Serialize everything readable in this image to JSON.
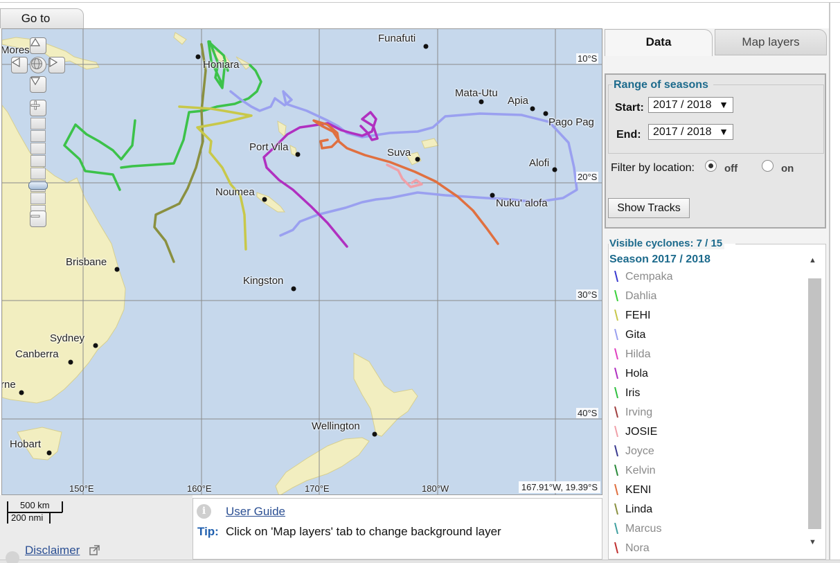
{
  "goto_tab": "Go to",
  "map": {
    "places": [
      {
        "id": "moresby",
        "label": "Mores"
      },
      {
        "id": "honiara",
        "label": "Honiara"
      },
      {
        "id": "funafuti",
        "label": "Funafuti"
      },
      {
        "id": "mata-utu",
        "label": "Mata-Utu"
      },
      {
        "id": "apia",
        "label": "Apia"
      },
      {
        "id": "pago-pago",
        "label": "Pago Pag"
      },
      {
        "id": "port-vila",
        "label": "Port Vila"
      },
      {
        "id": "suva",
        "label": "Suva"
      },
      {
        "id": "alofi",
        "label": "Alofi"
      },
      {
        "id": "noumea",
        "label": "Noumea"
      },
      {
        "id": "nukualofa",
        "label": "Nuku' alofa"
      },
      {
        "id": "brisbane",
        "label": "Brisbane"
      },
      {
        "id": "kingston",
        "label": "Kingston"
      },
      {
        "id": "sydney",
        "label": "Sydney"
      },
      {
        "id": "canberra",
        "label": "Canberra"
      },
      {
        "id": "melbourne",
        "label": "rne"
      },
      {
        "id": "wellington",
        "label": "Wellington"
      },
      {
        "id": "hobart",
        "label": "Hobart"
      }
    ],
    "lat_labels": [
      "10°S",
      "20°S",
      "30°S",
      "40°S"
    ],
    "lon_labels": [
      "150°E",
      "160°E",
      "170°E",
      "180°W"
    ],
    "coord_readout": "167.91°W, 19.39°S"
  },
  "scale": {
    "km": "500 km",
    "nmi": "200 nmi"
  },
  "disclaimer": "Disclaimer",
  "tip": {
    "guide_link": "User Guide",
    "label": "Tip:",
    "text": "Click on 'Map layers' tab to change background layer"
  },
  "tabs": {
    "data": "Data",
    "layers": "Map layers"
  },
  "range": {
    "legend": "Range of seasons",
    "start_label": "Start:",
    "start_value": "2017 / 2018",
    "end_label": "End:",
    "end_value": "2017 / 2018",
    "arrow": "▼"
  },
  "filter": {
    "label": "Filter by location:",
    "off": "off",
    "on": "on",
    "selected": "off"
  },
  "show_tracks": "Show Tracks",
  "visible_cyclones": "Visible cyclones: 7 / 15",
  "season_title": "Season 2017 / 2018",
  "cyclones": [
    {
      "name": "Cempaka",
      "color": "#3a3ad0",
      "visible": false
    },
    {
      "name": "Dahlia",
      "color": "#3ad13a",
      "visible": false
    },
    {
      "name": "FEHI",
      "color": "#c8c84a",
      "visible": true
    },
    {
      "name": "Gita",
      "color": "#9aa0f0",
      "visible": true
    },
    {
      "name": "Hilda",
      "color": "#e040c0",
      "visible": false
    },
    {
      "name": "Hola",
      "color": "#b030c0",
      "visible": true
    },
    {
      "name": "Iris",
      "color": "#30c040",
      "visible": true
    },
    {
      "name": "Irving",
      "color": "#a04040",
      "visible": false
    },
    {
      "name": "JOSIE",
      "color": "#f0a0a8",
      "visible": true
    },
    {
      "name": "Joyce",
      "color": "#3a3a90",
      "visible": false
    },
    {
      "name": "Kelvin",
      "color": "#2a8a3a",
      "visible": false
    },
    {
      "name": "KENI",
      "color": "#e07040",
      "visible": true
    },
    {
      "name": "Linda",
      "color": "#8a9040",
      "visible": true
    },
    {
      "name": "Marcus",
      "color": "#40a0a0",
      "visible": false
    },
    {
      "name": "Nora",
      "color": "#c03030",
      "visible": false
    }
  ]
}
